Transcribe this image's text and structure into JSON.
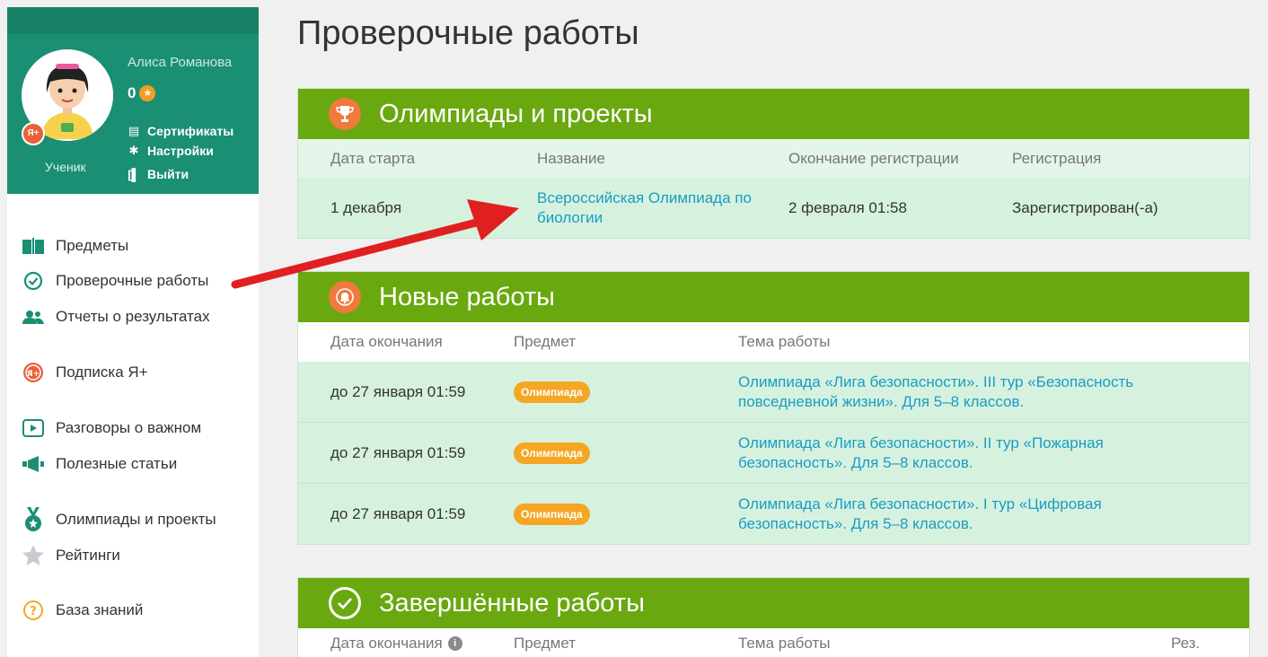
{
  "sidebar": {
    "user_name": "Алиса Романова",
    "points": "0",
    "role": "Ученик",
    "badge": "Я+",
    "links": [
      {
        "label": "Сертификаты",
        "icon": "certificate-icon"
      },
      {
        "label": "Настройки",
        "icon": "gear-icon"
      },
      {
        "label": "Выйти",
        "icon": "logout-icon"
      }
    ],
    "nav": [
      {
        "label": "Предметы",
        "icon": "book-icon"
      },
      {
        "label": "Проверочные работы",
        "icon": "check-circle-icon"
      },
      {
        "label": "Отчеты о результатах",
        "icon": "users-icon"
      },
      {
        "label": "Подписка Я+",
        "icon": "yaplus-icon"
      },
      {
        "label": "Разговоры о важном",
        "icon": "play-icon"
      },
      {
        "label": "Полезные статьи",
        "icon": "megaphone-icon"
      },
      {
        "label": "Олимпиады и проекты",
        "icon": "medal-icon"
      },
      {
        "label": "Рейтинги",
        "icon": "star-icon"
      },
      {
        "label": "База знаний",
        "icon": "question-icon"
      }
    ]
  },
  "main": {
    "title": "Проверочные работы",
    "olympiads": {
      "title": "Олимпиады и проекты",
      "headers": [
        "Дата старта",
        "Название",
        "Окончание регистрации",
        "Регистрация"
      ],
      "rows": [
        {
          "date": "1 декабря",
          "name": "Всероссийская Олимпиада по биологии",
          "reg_end": "2 февраля 01:58",
          "status": "Зарегистрирован(-а)"
        }
      ]
    },
    "new_works": {
      "title": "Новые работы",
      "headers": [
        "Дата окончания",
        "Предмет",
        "Тема работы"
      ],
      "rows": [
        {
          "date": "до 27 января 01:59",
          "subject": "Олимпиада",
          "topic": "Олимпиада «Лига безопасности». III тур «Безопасность повседневной жизни». Для 5–8 классов."
        },
        {
          "date": "до 27 января 01:59",
          "subject": "Олимпиада",
          "topic": "Олимпиада «Лига безопасности». II тур «Пожарная безопасность». Для 5–8 классов."
        },
        {
          "date": "до 27 января 01:59",
          "subject": "Олимпиада",
          "topic": "Олимпиада «Лига безопасности». I тур «Цифровая безопасность». Для 5–8 классов."
        }
      ]
    },
    "completed": {
      "title": "Завершённые работы",
      "headers": [
        "Дата окончания",
        "Предмет",
        "Тема работы",
        "Рез."
      ]
    }
  },
  "colors": {
    "green_header": "#6aa810",
    "sidebar_profile": "#1a8f74",
    "link": "#1a9cc4",
    "tag": "#f5a623",
    "arrow": "#e02020"
  }
}
